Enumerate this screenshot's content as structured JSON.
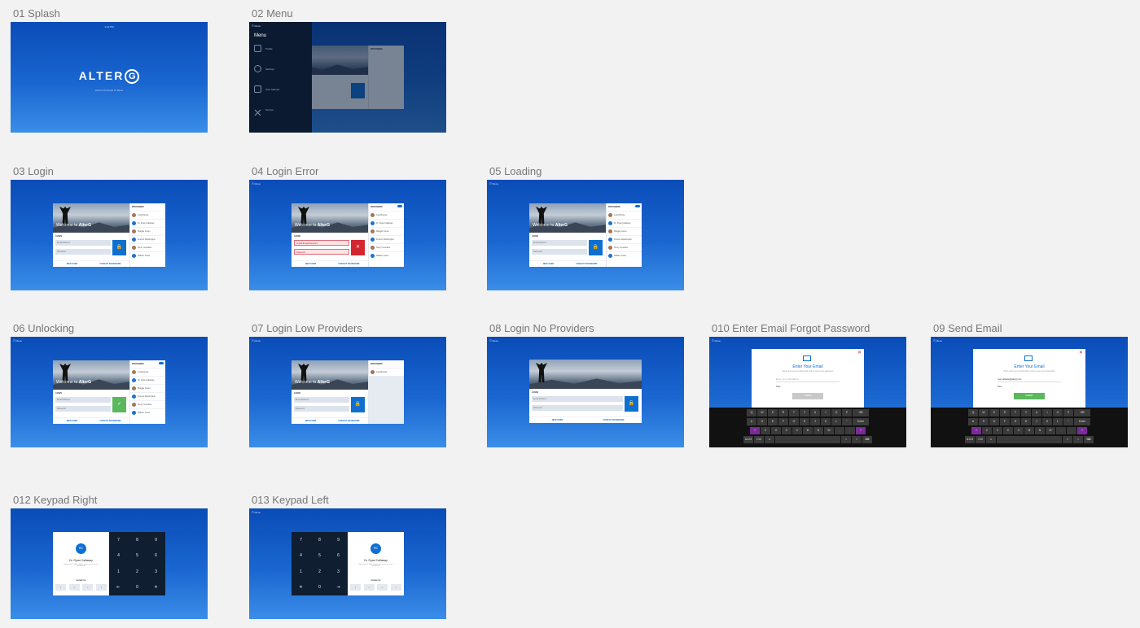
{
  "artboards": {
    "a01": "01 Splash",
    "a02": "02 Menu",
    "a03": "03 Login",
    "a04": "04 Login Error",
    "a05": "05 Loading",
    "a06": "06 Unlocking",
    "a07": "07 Login Low Providers",
    "a08": "08 Login No Providers",
    "a10": "010 Enter Email Forgot Password",
    "a09": "09 Send Email",
    "a12": "012 Keypad Right",
    "a13": "013 Keypad Left"
  },
  "splash": {
    "status": "1:13 PM",
    "logo": "ALTER",
    "logo_g": "G",
    "tagline": "Human Powered To Move"
  },
  "topbar": {
    "label": "☰ Menu"
  },
  "menu": {
    "title": "Menu",
    "items": [
      "Profile",
      "Settings",
      "User Manual",
      "Service"
    ]
  },
  "login": {
    "welcome_prefix": "Welcome to",
    "welcome_brand": "AlterG",
    "providers_title": "PROVIDERS",
    "login_label": "LOGIN",
    "email_placeholder": "Email Address",
    "password_placeholder": "Password",
    "error_email": "Invalid Email/Password",
    "go_icon": "🔒",
    "error_icon": "✕",
    "ok_icon": "✓",
    "new_user": "NEW USER",
    "forgot": "FORGOT PASSWORD",
    "providers": [
      "Lola Brooke",
      "Dr. Ryan Callaway",
      "Maggie Jones",
      "Francis Washington",
      "Henry Goodwin",
      "William Grant"
    ],
    "low_providers": [
      "Lola Brooke"
    ]
  },
  "email_modal": {
    "title": "Enter Your Email",
    "desc": "We'll send you a confirmation link to reset your password",
    "placeholder": "Enter your email address",
    "filled_value": "ryan.callaway@alterg.com",
    "note": "Note:",
    "button": "SUBMIT"
  },
  "keyboard": {
    "row1": [
      "Q",
      "W",
      "E",
      "R",
      "T",
      "Y",
      "U",
      "I",
      "O",
      "P",
      "⌫"
    ],
    "row2": [
      "A",
      "S",
      "D",
      "F",
      "G",
      "H",
      "J",
      "K",
      "L",
      "\"",
      "Enter"
    ],
    "row3": [
      "⇧",
      "Z",
      "X",
      "C",
      "V",
      "B",
      "N",
      "M",
      ",",
      ".",
      "⇧"
    ],
    "row4": [
      "&123",
      "Ctrl",
      "☺",
      "",
      "<",
      ">",
      "⌨"
    ]
  },
  "keypad": {
    "keys": [
      "7",
      "8",
      "9",
      "4",
      "5",
      "6",
      "1",
      "2",
      "3",
      "⇤",
      "0",
      "✳"
    ],
    "keys_left": [
      "7",
      "8",
      "9",
      "4",
      "5",
      "6",
      "1",
      "2",
      "3",
      "✳",
      "0",
      "⇥"
    ],
    "avatar": "RC",
    "name": "Dr. Ryan Callaway",
    "message": "Enter your 4-digit unique pin to access your dashboard",
    "pin_label": "ENTER PIN",
    "dots": [
      "•",
      "•",
      "•",
      "•"
    ]
  }
}
